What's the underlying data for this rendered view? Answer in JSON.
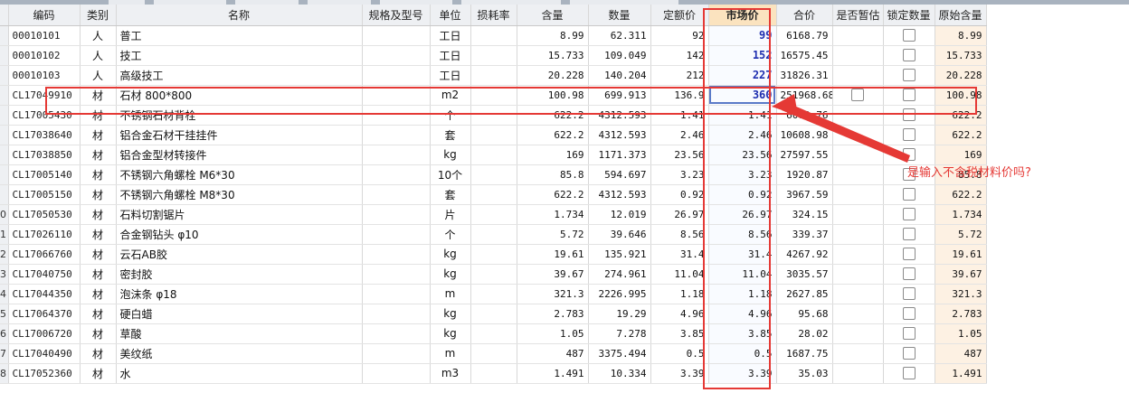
{
  "columns": [
    "编码",
    "类别",
    "名称",
    "规格及型号",
    "单位",
    "损耗率",
    "含量",
    "数量",
    "定额价",
    "市场价",
    "合价",
    "是否暂估",
    "锁定数量",
    "原始含量"
  ],
  "rows": [
    {
      "rn": "",
      "code": "00010101",
      "cat": "人",
      "name": "普工",
      "spec": "",
      "unit": "工日",
      "loss": "",
      "content": "8.99",
      "qty": "62.311",
      "quota": "92",
      "market": "99",
      "total": "6168.79",
      "est": "",
      "locked": true,
      "orig": "8.99"
    },
    {
      "rn": "",
      "code": "00010102",
      "cat": "人",
      "name": "技工",
      "spec": "",
      "unit": "工日",
      "loss": "",
      "content": "15.733",
      "qty": "109.049",
      "quota": "142",
      "market": "152",
      "total": "16575.45",
      "est": "",
      "locked": true,
      "orig": "15.733"
    },
    {
      "rn": "",
      "code": "00010103",
      "cat": "人",
      "name": "高级技工",
      "spec": "",
      "unit": "工日",
      "loss": "",
      "content": "20.228",
      "qty": "140.204",
      "quota": "212",
      "market": "227",
      "total": "31826.31",
      "est": "",
      "locked": true,
      "orig": "20.228"
    },
    {
      "rn": "",
      "code": "CL17049910",
      "cat": "材",
      "name": "石材 800*800",
      "spec": "",
      "unit": "m2",
      "loss": "",
      "content": "100.98",
      "qty": "699.913",
      "quota": "136.9",
      "market": "360",
      "total": "251968.68",
      "est": "box",
      "locked": true,
      "orig": "100.98"
    },
    {
      "rn": "",
      "code": "CL17005430",
      "cat": "材",
      "name": "不锈钢石材背栓",
      "spec": "",
      "unit": "个",
      "loss": "",
      "content": "622.2",
      "qty": "4312.593",
      "quota": "1.41",
      "market": "1.41",
      "total": "6080.76",
      "est": "",
      "locked": true,
      "orig": "622.2"
    },
    {
      "rn": "",
      "code": "CL17038640",
      "cat": "材",
      "name": "铝合金石材干挂挂件",
      "spec": "",
      "unit": "套",
      "loss": "",
      "content": "622.2",
      "qty": "4312.593",
      "quota": "2.46",
      "market": "2.46",
      "total": "10608.98",
      "est": "",
      "locked": true,
      "orig": "622.2"
    },
    {
      "rn": "",
      "code": "CL17038850",
      "cat": "材",
      "name": "铝合金型材转接件",
      "spec": "",
      "unit": "kg",
      "loss": "",
      "content": "169",
      "qty": "1171.373",
      "quota": "23.56",
      "market": "23.56",
      "total": "27597.55",
      "est": "",
      "locked": true,
      "orig": "169"
    },
    {
      "rn": "",
      "code": "CL17005140",
      "cat": "材",
      "name": "不锈钢六角螺栓 M6*30",
      "spec": "",
      "unit": "10个",
      "loss": "",
      "content": "85.8",
      "qty": "594.697",
      "quota": "3.23",
      "market": "3.23",
      "total": "1920.87",
      "est": "",
      "locked": true,
      "orig": "85.8"
    },
    {
      "rn": "",
      "code": "CL17005150",
      "cat": "材",
      "name": "不锈钢六角螺栓 M8*30",
      "spec": "",
      "unit": "套",
      "loss": "",
      "content": "622.2",
      "qty": "4312.593",
      "quota": "0.92",
      "market": "0.92",
      "total": "3967.59",
      "est": "",
      "locked": true,
      "orig": "622.2"
    },
    {
      "rn": "0",
      "code": "CL17050530",
      "cat": "材",
      "name": "石料切割锯片",
      "spec": "",
      "unit": "片",
      "loss": "",
      "content": "1.734",
      "qty": "12.019",
      "quota": "26.97",
      "market": "26.97",
      "total": "324.15",
      "est": "",
      "locked": true,
      "orig": "1.734"
    },
    {
      "rn": "1",
      "code": "CL17026110",
      "cat": "材",
      "name": "合金钢钻头 φ10",
      "spec": "",
      "unit": "个",
      "loss": "",
      "content": "5.72",
      "qty": "39.646",
      "quota": "8.56",
      "market": "8.56",
      "total": "339.37",
      "est": "",
      "locked": true,
      "orig": "5.72"
    },
    {
      "rn": "2",
      "code": "CL17066760",
      "cat": "材",
      "name": "云石AB胶",
      "spec": "",
      "unit": "kg",
      "loss": "",
      "content": "19.61",
      "qty": "135.921",
      "quota": "31.4",
      "market": "31.4",
      "total": "4267.92",
      "est": "",
      "locked": true,
      "orig": "19.61"
    },
    {
      "rn": "3",
      "code": "CL17040750",
      "cat": "材",
      "name": "密封胶",
      "spec": "",
      "unit": "kg",
      "loss": "",
      "content": "39.67",
      "qty": "274.961",
      "quota": "11.04",
      "market": "11.04",
      "total": "3035.57",
      "est": "",
      "locked": true,
      "orig": "39.67"
    },
    {
      "rn": "4",
      "code": "CL17044350",
      "cat": "材",
      "name": "泡沫条 φ18",
      "spec": "",
      "unit": "m",
      "loss": "",
      "content": "321.3",
      "qty": "2226.995",
      "quota": "1.18",
      "market": "1.18",
      "total": "2627.85",
      "est": "",
      "locked": true,
      "orig": "321.3"
    },
    {
      "rn": "5",
      "code": "CL17064370",
      "cat": "材",
      "name": "硬白蜡",
      "spec": "",
      "unit": "kg",
      "loss": "",
      "content": "2.783",
      "qty": "19.29",
      "quota": "4.96",
      "market": "4.96",
      "total": "95.68",
      "est": "",
      "locked": true,
      "orig": "2.783"
    },
    {
      "rn": "6",
      "code": "CL17006720",
      "cat": "材",
      "name": "草酸",
      "spec": "",
      "unit": "kg",
      "loss": "",
      "content": "1.05",
      "qty": "7.278",
      "quota": "3.85",
      "market": "3.85",
      "total": "28.02",
      "est": "",
      "locked": true,
      "orig": "1.05"
    },
    {
      "rn": "7",
      "code": "CL17040490",
      "cat": "材",
      "name": "美纹纸",
      "spec": "",
      "unit": "m",
      "loss": "",
      "content": "487",
      "qty": "3375.494",
      "quota": "0.5",
      "market": "0.5",
      "total": "1687.75",
      "est": "",
      "locked": true,
      "orig": "487"
    },
    {
      "rn": "8",
      "code": "CL17052360",
      "cat": "材",
      "name": "水",
      "spec": "",
      "unit": "m3",
      "loss": "",
      "content": "1.491",
      "qty": "10.334",
      "quota": "3.39",
      "market": "3.39",
      "total": "35.03",
      "est": "",
      "locked": true,
      "orig": "1.491"
    }
  ],
  "annotation": {
    "text": "是输入不含税材料价吗?",
    "color": "#e53935"
  },
  "colors": {
    "highlight_header": "#fbe3bf",
    "original_col": "#fdf1e3",
    "market_bold": "#1f2fb0"
  }
}
